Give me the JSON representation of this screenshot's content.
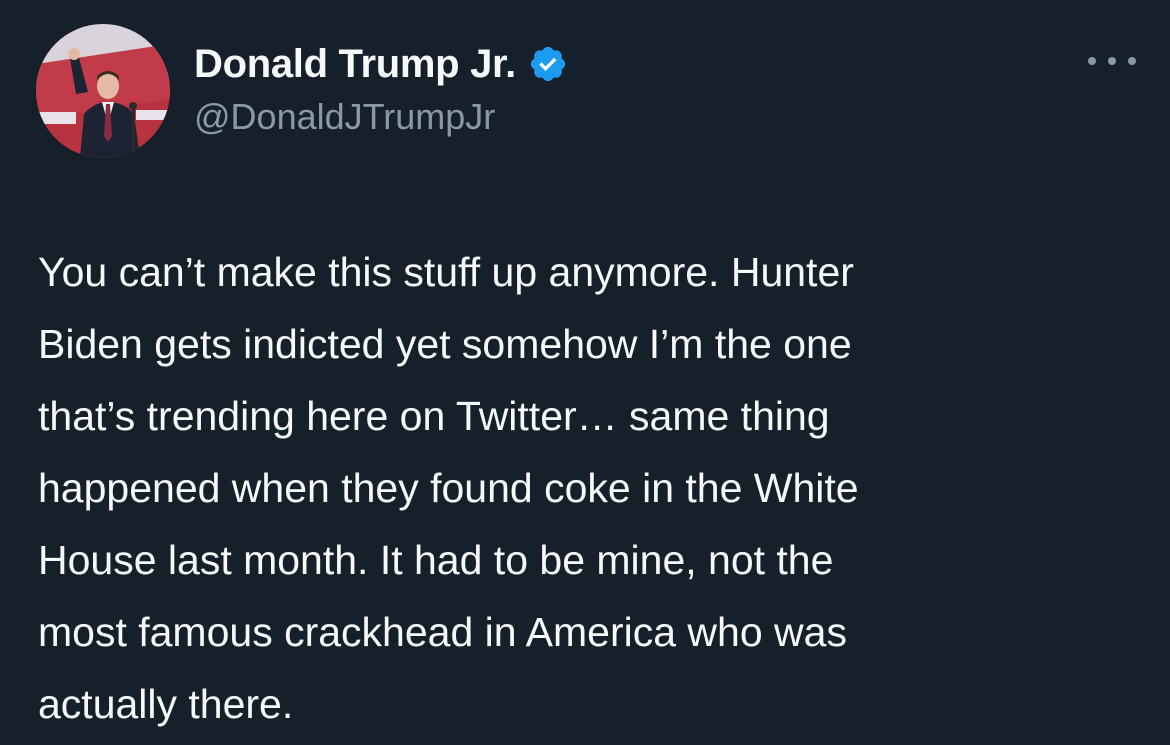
{
  "author": {
    "display_name": "Donald Trump Jr.",
    "handle": "@DonaldJTrumpJr",
    "avatar_icon": "profile-photo",
    "verified_icon": "verified-badge-icon",
    "verified_color": "#1d9bf0"
  },
  "tweet": {
    "lines": [
      "You can’t make this stuff up anymore. Hunter",
      "Biden gets indicted yet somehow I’m the one",
      "that’s trending here on Twitter… same thing",
      "happened when they found coke in the White",
      "House last month. It had to be mine, not the",
      "most famous crackhead in America who was",
      "actually there."
    ]
  },
  "menu": {
    "icon": "more-options-icon"
  },
  "colors": {
    "background": "#15202b",
    "primary_text": "#f7f9f9",
    "secondary_text": "#8b98a5"
  }
}
